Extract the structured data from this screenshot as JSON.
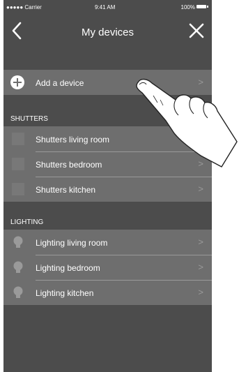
{
  "status_bar": {
    "carrier": "●●●●● Carrier",
    "time": "9:41 AM",
    "battery": "100%"
  },
  "nav": {
    "title": "My devices",
    "back_icon": "chevron-left-icon",
    "close_icon": "close-icon"
  },
  "add_device": {
    "label": "Add a device",
    "icon": "plus-circle-icon"
  },
  "sections": [
    {
      "title": "SHUTTERS",
      "items": [
        {
          "label": "Shutters living room",
          "icon": "shutter-icon"
        },
        {
          "label": "Shutters bedroom",
          "icon": "shutter-icon"
        },
        {
          "label": "Shutters kitchen",
          "icon": "shutter-icon"
        }
      ]
    },
    {
      "title": "LIGHTING",
      "items": [
        {
          "label": "Lighting living room",
          "icon": "bulb-icon"
        },
        {
          "label": "Lighting bedroom",
          "icon": "bulb-icon"
        },
        {
          "label": "Lighting kitchen",
          "icon": "bulb-icon"
        }
      ]
    }
  ],
  "chevron": ">",
  "colors": {
    "background": "#4c4c4c",
    "row": "#6e6e6e",
    "text": "#ffffff"
  }
}
